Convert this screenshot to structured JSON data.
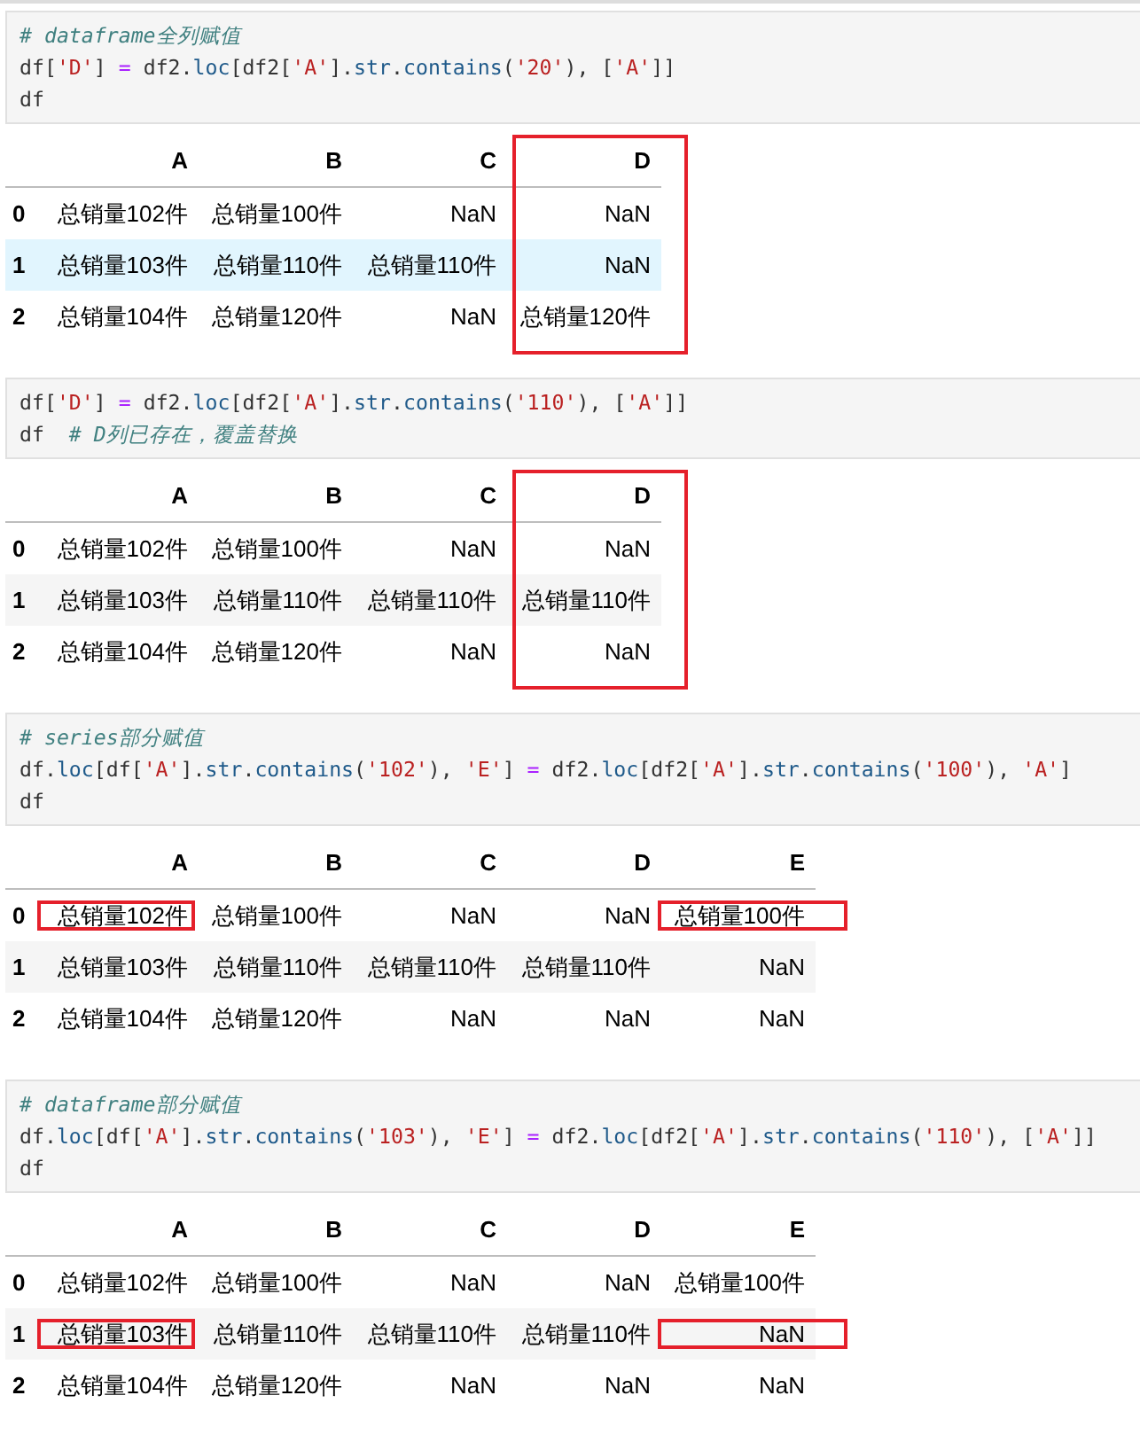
{
  "cells": [
    {
      "code": [
        {
          "tokens": [
            {
              "kind": "comment",
              "text": "# dataframe全列赋值"
            }
          ]
        },
        {
          "tokens": [
            {
              "kind": "plain",
              "text": "df["
            },
            {
              "kind": "string",
              "text": "'D'"
            },
            {
              "kind": "plain",
              "text": "] "
            },
            {
              "kind": "op",
              "text": "="
            },
            {
              "kind": "plain",
              "text": " df2."
            },
            {
              "kind": "attr",
              "text": "loc"
            },
            {
              "kind": "plain",
              "text": "[df2["
            },
            {
              "kind": "string",
              "text": "'A'"
            },
            {
              "kind": "plain",
              "text": "]."
            },
            {
              "kind": "attr",
              "text": "str"
            },
            {
              "kind": "plain",
              "text": "."
            },
            {
              "kind": "attr",
              "text": "contains"
            },
            {
              "kind": "plain",
              "text": "("
            },
            {
              "kind": "string",
              "text": "'20'"
            },
            {
              "kind": "plain",
              "text": "), ["
            },
            {
              "kind": "string",
              "text": "'A'"
            },
            {
              "kind": "plain",
              "text": "]]"
            }
          ]
        },
        {
          "tokens": [
            {
              "kind": "plain",
              "text": "df"
            }
          ]
        }
      ],
      "table": {
        "columns": [
          {
            "label": "A",
            "marked": false
          },
          {
            "label": "B",
            "marked": false
          },
          {
            "label": "C",
            "marked": false
          },
          {
            "label": "D",
            "marked": true
          }
        ],
        "rows": [
          {
            "index": "0",
            "hovered": false,
            "cells": [
              {
                "text": "总销量102件",
                "marked": false
              },
              {
                "text": "总销量100件",
                "marked": false
              },
              {
                "text": "NaN",
                "marked": false
              },
              {
                "text": "NaN",
                "marked": false
              }
            ]
          },
          {
            "index": "1",
            "hovered": true,
            "cells": [
              {
                "text": "总销量103件",
                "marked": false
              },
              {
                "text": "总销量110件",
                "marked": false
              },
              {
                "text": "总销量110件",
                "marked": false
              },
              {
                "text": "NaN",
                "marked": false
              }
            ]
          },
          {
            "index": "2",
            "hovered": false,
            "cells": [
              {
                "text": "总销量104件",
                "marked": false
              },
              {
                "text": "总销量120件",
                "marked": false
              },
              {
                "text": "NaN",
                "marked": false
              },
              {
                "text": "总销量120件",
                "marked": false
              }
            ]
          }
        ]
      }
    },
    {
      "code": [
        {
          "tokens": [
            {
              "kind": "plain",
              "text": "df["
            },
            {
              "kind": "string",
              "text": "'D'"
            },
            {
              "kind": "plain",
              "text": "] "
            },
            {
              "kind": "op",
              "text": "="
            },
            {
              "kind": "plain",
              "text": " df2."
            },
            {
              "kind": "attr",
              "text": "loc"
            },
            {
              "kind": "plain",
              "text": "[df2["
            },
            {
              "kind": "string",
              "text": "'A'"
            },
            {
              "kind": "plain",
              "text": "]."
            },
            {
              "kind": "attr",
              "text": "str"
            },
            {
              "kind": "plain",
              "text": "."
            },
            {
              "kind": "attr",
              "text": "contains"
            },
            {
              "kind": "plain",
              "text": "("
            },
            {
              "kind": "string",
              "text": "'110'"
            },
            {
              "kind": "plain",
              "text": "), ["
            },
            {
              "kind": "string",
              "text": "'A'"
            },
            {
              "kind": "plain",
              "text": "]]"
            }
          ]
        },
        {
          "tokens": [
            {
              "kind": "plain",
              "text": "df  "
            },
            {
              "kind": "comment",
              "text": "# D列已存在，覆盖替换"
            }
          ]
        }
      ],
      "table": {
        "columns": [
          {
            "label": "A",
            "marked": false
          },
          {
            "label": "B",
            "marked": false
          },
          {
            "label": "C",
            "marked": false
          },
          {
            "label": "D",
            "marked": true
          }
        ],
        "rows": [
          {
            "index": "0",
            "hovered": false,
            "cells": [
              {
                "text": "总销量102件",
                "marked": false
              },
              {
                "text": "总销量100件",
                "marked": false
              },
              {
                "text": "NaN",
                "marked": false
              },
              {
                "text": "NaN",
                "marked": false
              }
            ]
          },
          {
            "index": "1",
            "hovered": false,
            "cells": [
              {
                "text": "总销量103件",
                "marked": false
              },
              {
                "text": "总销量110件",
                "marked": false
              },
              {
                "text": "总销量110件",
                "marked": false
              },
              {
                "text": "总销量110件",
                "marked": false
              }
            ]
          },
          {
            "index": "2",
            "hovered": false,
            "cells": [
              {
                "text": "总销量104件",
                "marked": false
              },
              {
                "text": "总销量120件",
                "marked": false
              },
              {
                "text": "NaN",
                "marked": false
              },
              {
                "text": "NaN",
                "marked": false
              }
            ]
          }
        ]
      }
    },
    {
      "code": [
        {
          "tokens": [
            {
              "kind": "comment",
              "text": "# series部分赋值"
            }
          ]
        },
        {
          "tokens": [
            {
              "kind": "plain",
              "text": "df."
            },
            {
              "kind": "attr",
              "text": "loc"
            },
            {
              "kind": "plain",
              "text": "[df["
            },
            {
              "kind": "string",
              "text": "'A'"
            },
            {
              "kind": "plain",
              "text": "]."
            },
            {
              "kind": "attr",
              "text": "str"
            },
            {
              "kind": "plain",
              "text": "."
            },
            {
              "kind": "attr",
              "text": "contains"
            },
            {
              "kind": "plain",
              "text": "("
            },
            {
              "kind": "string",
              "text": "'102'"
            },
            {
              "kind": "plain",
              "text": "), "
            },
            {
              "kind": "string",
              "text": "'E'"
            },
            {
              "kind": "plain",
              "text": "] "
            },
            {
              "kind": "op",
              "text": "="
            },
            {
              "kind": "plain",
              "text": " df2."
            },
            {
              "kind": "attr",
              "text": "loc"
            },
            {
              "kind": "plain",
              "text": "[df2["
            },
            {
              "kind": "string",
              "text": "'A'"
            },
            {
              "kind": "plain",
              "text": "]."
            },
            {
              "kind": "attr",
              "text": "str"
            },
            {
              "kind": "plain",
              "text": "."
            },
            {
              "kind": "attr",
              "text": "contains"
            },
            {
              "kind": "plain",
              "text": "("
            },
            {
              "kind": "string",
              "text": "'100'"
            },
            {
              "kind": "plain",
              "text": "), "
            },
            {
              "kind": "string",
              "text": "'A'"
            },
            {
              "kind": "plain",
              "text": "]"
            }
          ]
        },
        {
          "tokens": [
            {
              "kind": "plain",
              "text": "df"
            }
          ]
        }
      ],
      "table": {
        "columns": [
          {
            "label": "A",
            "marked": false
          },
          {
            "label": "B",
            "marked": false
          },
          {
            "label": "C",
            "marked": false
          },
          {
            "label": "D",
            "marked": false
          },
          {
            "label": "E",
            "marked": false
          }
        ],
        "rows": [
          {
            "index": "0",
            "hovered": false,
            "cells": [
              {
                "text": "总销量102件",
                "marked": true
              },
              {
                "text": "总销量100件",
                "marked": false
              },
              {
                "text": "NaN",
                "marked": false
              },
              {
                "text": "NaN",
                "marked": false
              },
              {
                "text": "总销量100件",
                "marked": true
              }
            ]
          },
          {
            "index": "1",
            "hovered": false,
            "cells": [
              {
                "text": "总销量103件",
                "marked": false
              },
              {
                "text": "总销量110件",
                "marked": false
              },
              {
                "text": "总销量110件",
                "marked": false
              },
              {
                "text": "总销量110件",
                "marked": false
              },
              {
                "text": "NaN",
                "marked": false
              }
            ]
          },
          {
            "index": "2",
            "hovered": false,
            "cells": [
              {
                "text": "总销量104件",
                "marked": false
              },
              {
                "text": "总销量120件",
                "marked": false
              },
              {
                "text": "NaN",
                "marked": false
              },
              {
                "text": "NaN",
                "marked": false
              },
              {
                "text": "NaN",
                "marked": false
              }
            ]
          }
        ]
      }
    },
    {
      "code": [
        {
          "tokens": [
            {
              "kind": "comment",
              "text": "# dataframe部分赋值"
            }
          ]
        },
        {
          "tokens": [
            {
              "kind": "plain",
              "text": "df."
            },
            {
              "kind": "attr",
              "text": "loc"
            },
            {
              "kind": "plain",
              "text": "[df["
            },
            {
              "kind": "string",
              "text": "'A'"
            },
            {
              "kind": "plain",
              "text": "]."
            },
            {
              "kind": "attr",
              "text": "str"
            },
            {
              "kind": "plain",
              "text": "."
            },
            {
              "kind": "attr",
              "text": "contains"
            },
            {
              "kind": "plain",
              "text": "("
            },
            {
              "kind": "string",
              "text": "'103'"
            },
            {
              "kind": "plain",
              "text": "), "
            },
            {
              "kind": "string",
              "text": "'E'"
            },
            {
              "kind": "plain",
              "text": "] "
            },
            {
              "kind": "op",
              "text": "="
            },
            {
              "kind": "plain",
              "text": " df2."
            },
            {
              "kind": "attr",
              "text": "loc"
            },
            {
              "kind": "plain",
              "text": "[df2["
            },
            {
              "kind": "string",
              "text": "'A'"
            },
            {
              "kind": "plain",
              "text": "]."
            },
            {
              "kind": "attr",
              "text": "str"
            },
            {
              "kind": "plain",
              "text": "."
            },
            {
              "kind": "attr",
              "text": "contains"
            },
            {
              "kind": "plain",
              "text": "("
            },
            {
              "kind": "string",
              "text": "'110'"
            },
            {
              "kind": "plain",
              "text": "), ["
            },
            {
              "kind": "string",
              "text": "'A'"
            },
            {
              "kind": "plain",
              "text": "]]"
            }
          ]
        },
        {
          "tokens": [
            {
              "kind": "plain",
              "text": "df"
            }
          ]
        }
      ],
      "table": {
        "columns": [
          {
            "label": "A",
            "marked": false
          },
          {
            "label": "B",
            "marked": false
          },
          {
            "label": "C",
            "marked": false
          },
          {
            "label": "D",
            "marked": false
          },
          {
            "label": "E",
            "marked": false
          }
        ],
        "rows": [
          {
            "index": "0",
            "hovered": false,
            "cells": [
              {
                "text": "总销量102件",
                "marked": false
              },
              {
                "text": "总销量100件",
                "marked": false
              },
              {
                "text": "NaN",
                "marked": false
              },
              {
                "text": "NaN",
                "marked": false
              },
              {
                "text": "总销量100件",
                "marked": false
              }
            ]
          },
          {
            "index": "1",
            "hovered": false,
            "cells": [
              {
                "text": "总销量103件",
                "marked": true
              },
              {
                "text": "总销量110件",
                "marked": false
              },
              {
                "text": "总销量110件",
                "marked": false
              },
              {
                "text": "总销量110件",
                "marked": false
              },
              {
                "text": "NaN",
                "marked": true
              }
            ]
          },
          {
            "index": "2",
            "hovered": false,
            "cells": [
              {
                "text": "总销量104件",
                "marked": false
              },
              {
                "text": "总销量120件",
                "marked": false
              },
              {
                "text": "NaN",
                "marked": false
              },
              {
                "text": "NaN",
                "marked": false
              },
              {
                "text": "NaN",
                "marked": false
              }
            ]
          }
        ]
      }
    }
  ]
}
